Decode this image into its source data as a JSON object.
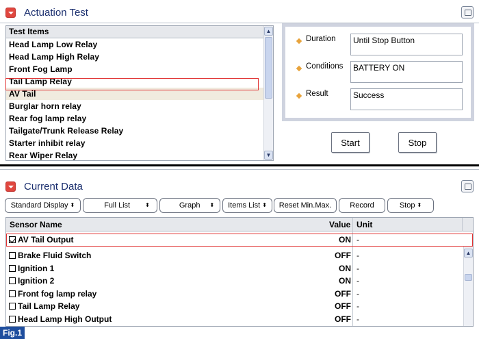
{
  "actuation": {
    "title": "Actuation Test",
    "list_header": "Test Items",
    "items": [
      "Head Lamp Low Relay",
      "Head Lamp High Relay",
      "Front Fog Lamp",
      "Tail Lamp Relay",
      "AV Tail",
      "Burglar horn relay",
      "Rear fog lamp relay",
      "Tailgate/Trunk Release Relay",
      "Starter inhibit relay",
      "Rear Wiper Relay"
    ],
    "duration_label": "Duration",
    "duration_value": "Until Stop Button",
    "conditions_label": "Conditions",
    "conditions_value": "BATTERY ON",
    "result_label": "Result",
    "result_value": "Success",
    "start_label": "Start",
    "stop_label": "Stop"
  },
  "current_data": {
    "title": "Current Data",
    "toolbar": {
      "standard_display": "Standard Display",
      "full_list": "Full List",
      "graph": "Graph",
      "items_list": "Items List",
      "reset_minmax": "Reset Min.Max.",
      "record": "Record",
      "stop": "Stop"
    },
    "columns": {
      "sensor_name": "Sensor Name",
      "value": "Value",
      "unit": "Unit"
    },
    "rows": [
      {
        "name": "AV Tail Output",
        "value": "ON",
        "unit": "-",
        "checked": true
      },
      {
        "name": "Brake Fluid Switch",
        "value": "OFF",
        "unit": "-",
        "checked": false
      },
      {
        "name": "Ignition 1",
        "value": "ON",
        "unit": "-",
        "checked": false
      },
      {
        "name": "Ignition 2",
        "value": "ON",
        "unit": "-",
        "checked": false
      },
      {
        "name": "Front fog lamp relay",
        "value": "OFF",
        "unit": "-",
        "checked": false
      },
      {
        "name": "Tail Lamp Relay",
        "value": "OFF",
        "unit": "-",
        "checked": false
      },
      {
        "name": "Head Lamp High Output",
        "value": "OFF",
        "unit": "-",
        "checked": false
      }
    ]
  },
  "figure_label": "Fig.1",
  "colors": {
    "accent_red": "#e0463e",
    "title_blue": "#1a2e6e",
    "highlight": "#e03232",
    "bullet": "#e8a33c",
    "fig_bg": "#1f4e9e"
  }
}
